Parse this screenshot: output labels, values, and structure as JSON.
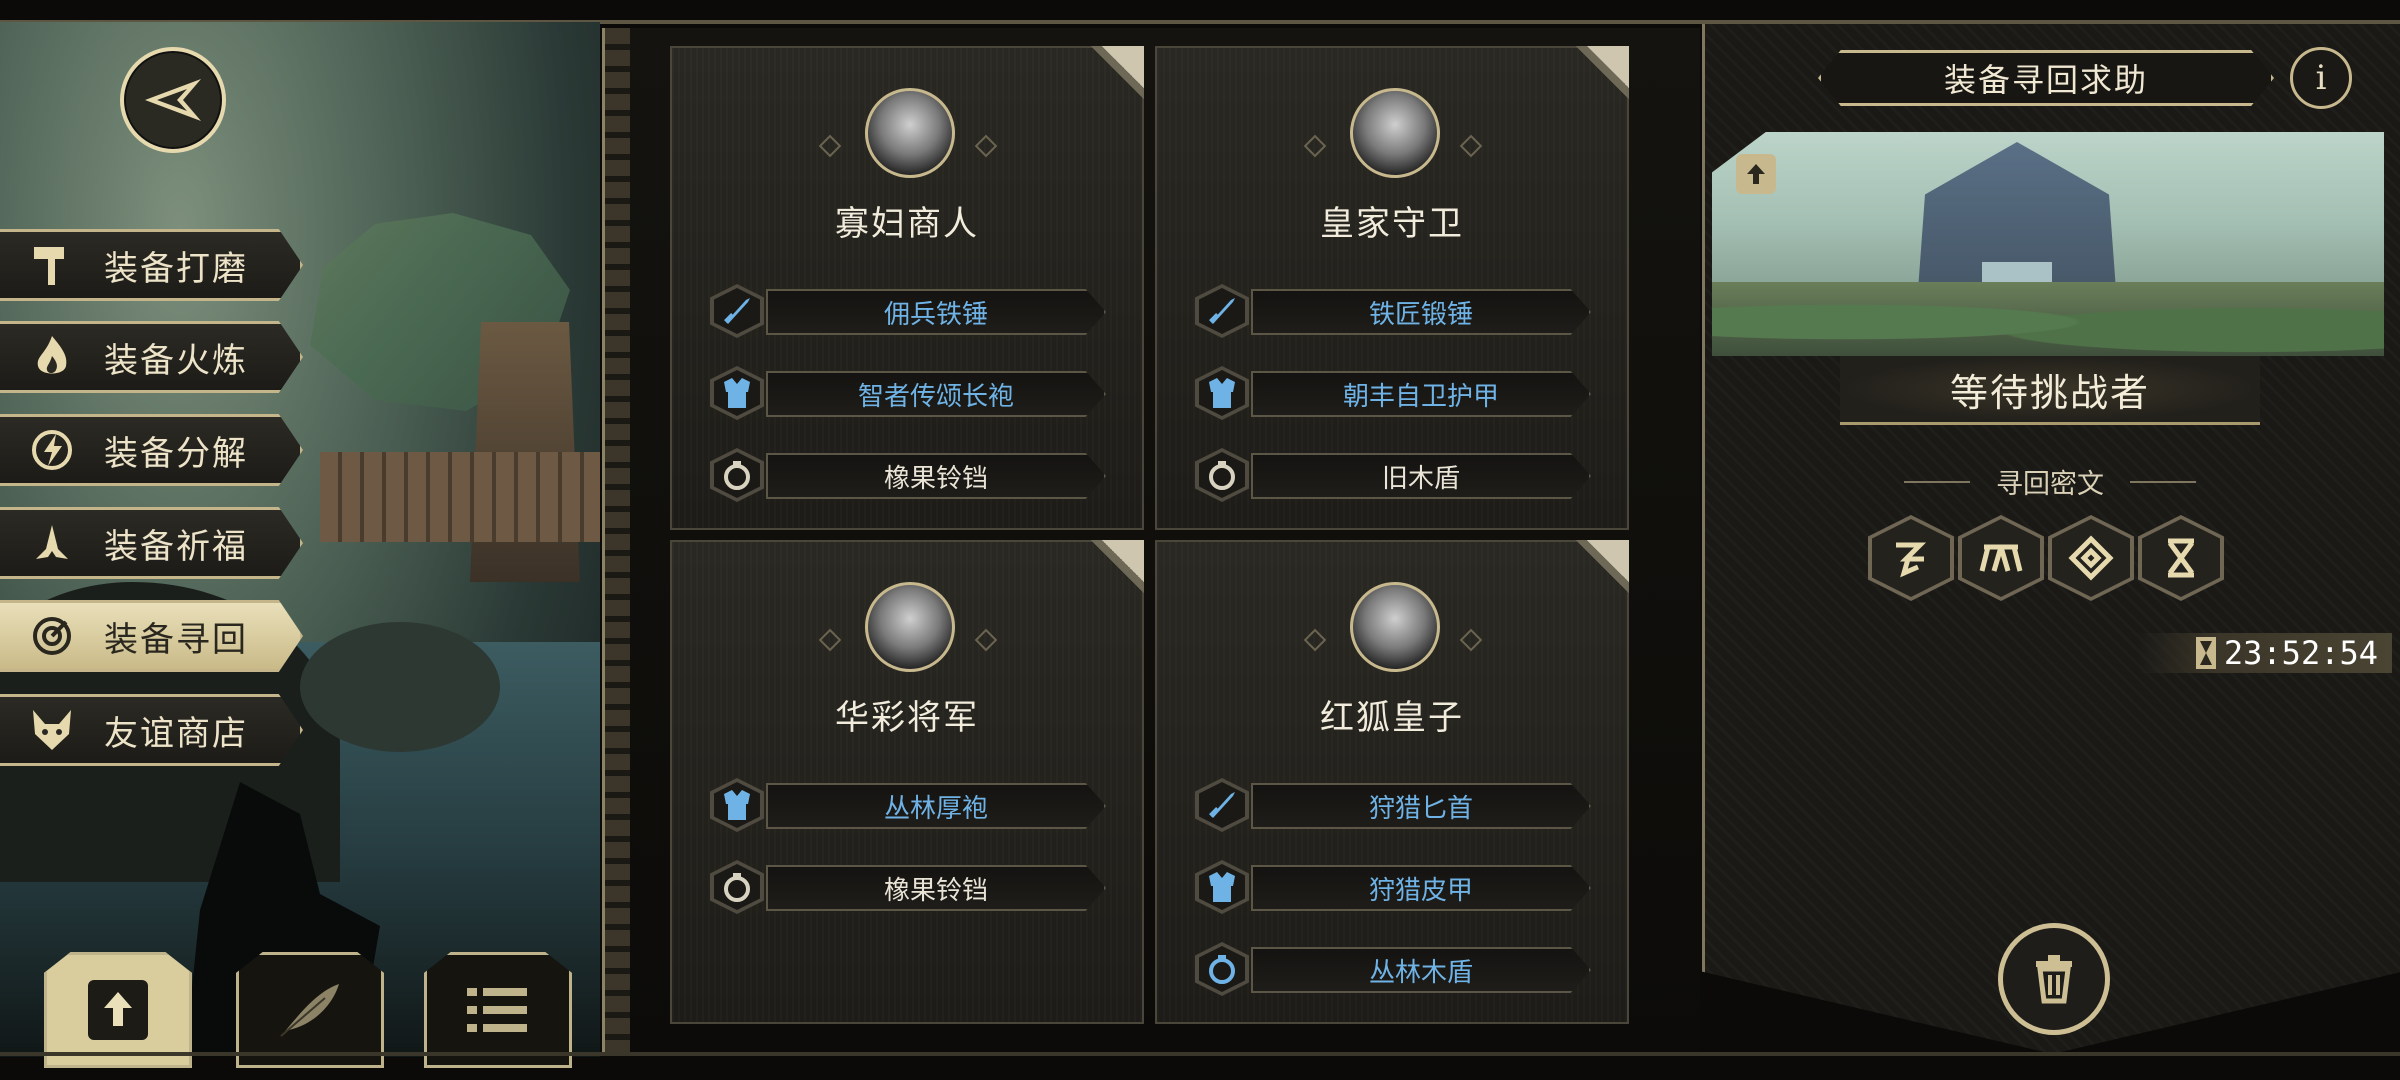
{
  "left_menu": {
    "items": [
      {
        "label": "装备打磨",
        "icon": "hammer-icon"
      },
      {
        "label": "装备火炼",
        "icon": "flame-icon"
      },
      {
        "label": "装备分解",
        "icon": "decompose-icon"
      },
      {
        "label": "装备祈福",
        "icon": "pray-icon"
      },
      {
        "label": "装备寻回",
        "icon": "retrieve-icon",
        "active": true
      },
      {
        "label": "友谊商店",
        "icon": "fox-icon"
      }
    ]
  },
  "bottom_toolbar": [
    "upload-icon",
    "feather-icon",
    "list-icon"
  ],
  "cards": [
    {
      "name": "寡妇商人",
      "items": [
        {
          "label": "佣兵铁锤",
          "type": "weapon",
          "rarity": "blue"
        },
        {
          "label": "智者传颂长袍",
          "type": "armor",
          "rarity": "blue"
        },
        {
          "label": "橡果铃铛",
          "type": "accessory",
          "rarity": "white"
        }
      ]
    },
    {
      "name": "皇家守卫",
      "items": [
        {
          "label": "铁匠锻锤",
          "type": "weapon",
          "rarity": "blue"
        },
        {
          "label": "朝丰自卫护甲",
          "type": "armor",
          "rarity": "blue"
        },
        {
          "label": "旧木盾",
          "type": "accessory",
          "rarity": "white"
        }
      ]
    },
    {
      "name": "华彩将军",
      "items": [
        {
          "label": "丛林厚袍",
          "type": "armor",
          "rarity": "blue"
        },
        {
          "label": "橡果铃铛",
          "type": "accessory",
          "rarity": "white"
        }
      ]
    },
    {
      "name": "红狐皇子",
      "items": [
        {
          "label": "狩猎匕首",
          "type": "weapon",
          "rarity": "blue"
        },
        {
          "label": "狩猎皮甲",
          "type": "armor",
          "rarity": "blue"
        },
        {
          "label": "丛林木盾",
          "type": "accessory",
          "rarity": "blue"
        }
      ]
    }
  ],
  "right_panel": {
    "title": "装备寻回求助",
    "info": "i",
    "status": "等待挑战者",
    "runes_label": "寻回密文",
    "runes": [
      "rune-1-icon",
      "rune-2-icon",
      "rune-3-icon",
      "rune-4-icon"
    ],
    "timer": "23:52:54"
  },
  "colors": {
    "accent_gold": "#c7b98d",
    "blue_item": "#6fb3e6",
    "white_item": "#e9e4d6"
  }
}
